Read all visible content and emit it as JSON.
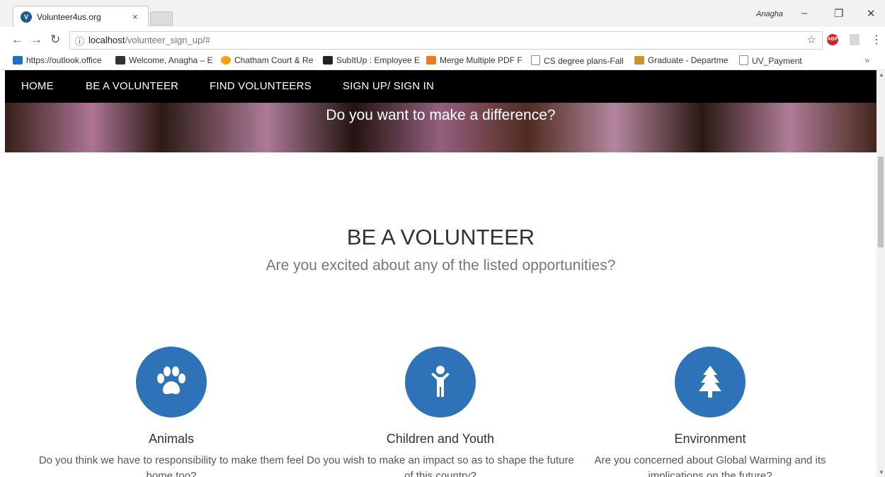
{
  "browser": {
    "tab_title": "Volunteer4us.org",
    "tab_close": "×",
    "favicon_text": "V",
    "profile": "Anagha",
    "url_host": "localhost",
    "url_path": "/volunteer_sign_up/#",
    "abp_label": "ABP",
    "bookmarks": [
      {
        "label": "https://outlook.office",
        "color": "#1f6fc5"
      },
      {
        "label": "Welcome, Anagha – E",
        "color": "#333333"
      },
      {
        "label": "Chatham Court & Re",
        "color": "#f1a40f"
      },
      {
        "label": "SubItUp : Employee E",
        "color": "#222222"
      },
      {
        "label": "Merge Multiple PDF F",
        "color": "#f07a1a"
      },
      {
        "label": "CS degree plans-Fall",
        "color": "#ffffff"
      },
      {
        "label": "Graduate - Departme",
        "color": "#c9962a"
      },
      {
        "label": "UV_Payment",
        "color": "#ffffff"
      }
    ],
    "bookmarks_more": "»"
  },
  "nav": {
    "items": [
      "HOME",
      "BE A VOLUNTEER",
      "FIND VOLUNTEERS",
      "SIGN UP/ SIGN IN"
    ]
  },
  "hero": {
    "text": "Do you want to make a difference?"
  },
  "section": {
    "title": "BE A VOLUNTEER",
    "subtitle": "Are you excited about any of the listed opportunities?"
  },
  "cards": [
    {
      "title": "Animals",
      "desc": "Do you think we have to responsibility to make them feel home too?",
      "icon": "paw-icon"
    },
    {
      "title": "Children and Youth",
      "desc": "Do you wish to make an impact so as to shape the future of this country?",
      "icon": "child-icon"
    },
    {
      "title": "Environment",
      "desc": "Are you concerned about Global Warming and its implications on the future?",
      "icon": "tree-icon"
    }
  ],
  "colors": {
    "accent": "#2e73b8",
    "navbar": "#000000"
  }
}
